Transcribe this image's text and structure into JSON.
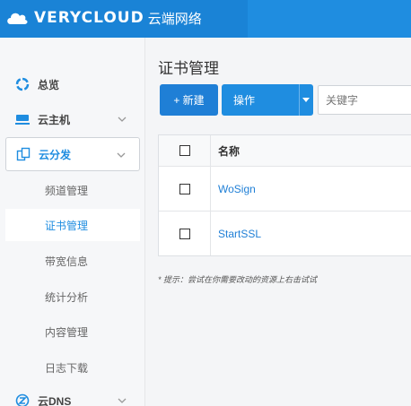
{
  "header": {
    "brand_text": "VERYCLOUD",
    "brand_cn": "云端网络"
  },
  "sidebar": {
    "items": [
      {
        "label": "总览",
        "icon": "overview-icon"
      },
      {
        "label": "云主机",
        "icon": "server-icon"
      },
      {
        "label": "云分发",
        "icon": "cdn-icon"
      },
      {
        "label": "云DNS",
        "icon": "dns-icon"
      }
    ],
    "sub_items": [
      {
        "label": "频道管理"
      },
      {
        "label": "证书管理"
      },
      {
        "label": "带宽信息"
      },
      {
        "label": "统计分析"
      },
      {
        "label": "内容管理"
      },
      {
        "label": "日志下载"
      }
    ]
  },
  "main": {
    "title": "证书管理",
    "new_button": "+ 新建",
    "ops_button": "操作",
    "search_placeholder": "关键字",
    "table": {
      "columns": [
        "名称"
      ],
      "rows": [
        {
          "name": "WoSign"
        },
        {
          "name": "StartSSL"
        }
      ]
    },
    "hint": "* 提示：尝试在你需要改动的资源上右击试试"
  },
  "colors": {
    "brand_blue": "#1f8de0",
    "link_blue": "#1f7fd6"
  }
}
